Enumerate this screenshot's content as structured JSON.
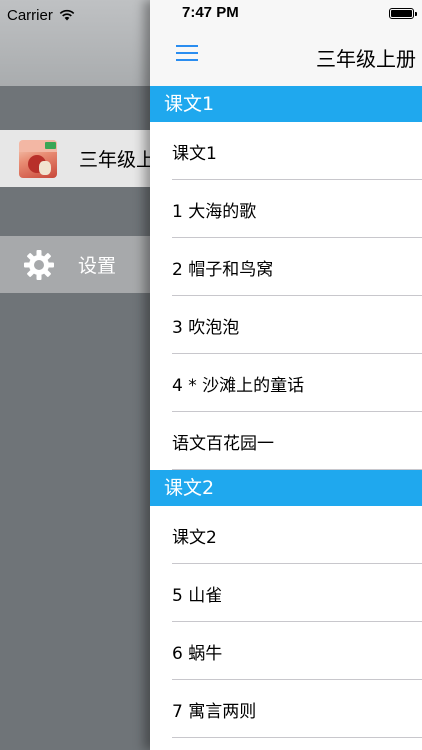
{
  "status_bar": {
    "carrier": "Carrier",
    "time": "7:47 PM"
  },
  "drawer": {
    "items": [
      {
        "label": "三年级上",
        "icon": "book-cover-icon"
      },
      {
        "label": "设置",
        "icon": "gear-icon"
      }
    ]
  },
  "nav": {
    "title": "三年级上册",
    "menu_icon": "hamburger-menu-icon"
  },
  "sections": [
    {
      "header": "课文1",
      "rows": [
        "课文1",
        "1 大海的歌",
        "2 帽子和鸟窝",
        "3 吹泡泡",
        "4 * 沙滩上的童话",
        "语文百花园一"
      ]
    },
    {
      "header": "课文2",
      "rows": [
        "课文2",
        "5 山雀",
        "6 蜗牛",
        "7 寓言两则"
      ]
    }
  ],
  "colors": {
    "section_header": "#1fa8ee",
    "accent": "#2a8df0",
    "drawer_background": "#6f7478",
    "drawer_selected": "#e7e7e7"
  }
}
